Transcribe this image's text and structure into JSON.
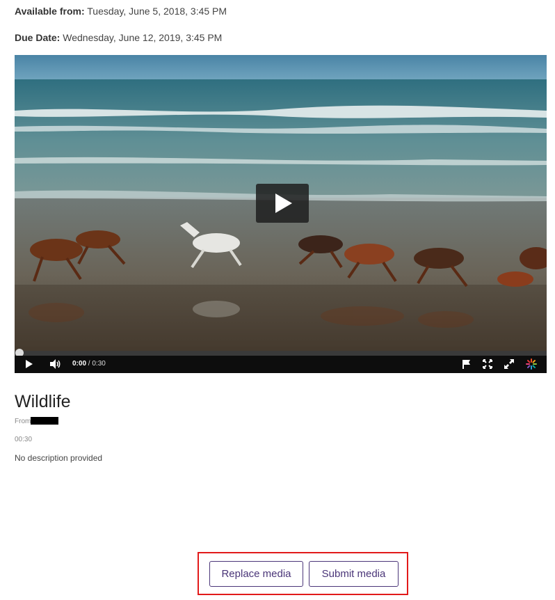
{
  "assignment": {
    "available_label": "Available from:",
    "available_value": "Tuesday, June 5, 2018, 3:45 PM",
    "due_label": "Due Date:",
    "due_value": "Wednesday, June 12, 2019, 3:45 PM"
  },
  "player": {
    "current_time": "0:00",
    "duration_text": "/ 0:30",
    "progress": 0,
    "icons": [
      "play-icon",
      "volume-icon",
      "flag-icon",
      "resize-icon",
      "fullscreen-icon",
      "loading-spinner-icon"
    ],
    "colors": {
      "controls_bg": "#0d0d0d",
      "progress_track": "#3a3a3a"
    }
  },
  "media": {
    "title": "Wildlife",
    "from_label": "From",
    "duration": "00:30",
    "description": "No description provided"
  },
  "actions": {
    "replace_label": "Replace media",
    "submit_label": "Submit media",
    "accent_color": "#4a3578",
    "highlight_color": "#e21a1a"
  }
}
